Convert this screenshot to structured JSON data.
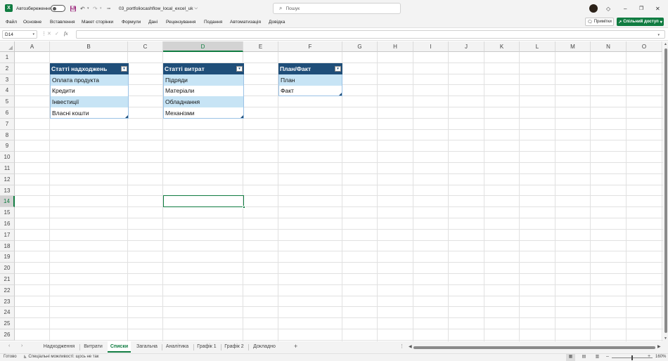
{
  "titlebar": {
    "app_icon": "X",
    "autosave_label": "Автозбереження",
    "autosave_state": "off",
    "filename": "03_portfoliocashflow_local_excel_uk",
    "filename_chevron": "⌵",
    "search_placeholder": "Пошук",
    "icons": [
      "excel-logo-icon",
      "save-icon",
      "undo-icon",
      "redo-icon",
      "search-icon",
      "diamond-icon",
      "minimize-icon",
      "maximize-icon",
      "close-icon"
    ]
  },
  "ribbon": {
    "tabs": [
      "Файл",
      "Основне",
      "Вставлення",
      "Макет сторінки",
      "Формули",
      "Дані",
      "Рецензування",
      "Подання",
      "Автоматизація",
      "Довідка"
    ],
    "notes_label": "Примітки",
    "share_label": "Спільний доступ"
  },
  "formula_bar": {
    "name_box": "D14",
    "fx_label": "fx",
    "formula": ""
  },
  "grid": {
    "columns": [
      "A",
      "B",
      "C",
      "D",
      "E",
      "F",
      "G",
      "H",
      "I",
      "J",
      "K",
      "L",
      "M",
      "N",
      "O"
    ],
    "rows": [
      "1",
      "2",
      "3",
      "4",
      "5",
      "6",
      "7",
      "8",
      "9",
      "10",
      "11",
      "12",
      "13",
      "14",
      "15",
      "16",
      "17",
      "18",
      "19",
      "20",
      "21",
      "22",
      "23",
      "24",
      "25",
      "26"
    ],
    "selected_column": "D",
    "selected_row": "14"
  },
  "tables": {
    "income": {
      "header": "Статті надходжень",
      "items": [
        "Оплата продукта",
        "Кредити",
        "Інвестиції",
        "Власні кошти"
      ]
    },
    "expenses": {
      "header": "Статті витрат",
      "items": [
        "Підряди",
        "Матеріали",
        "Обладнання",
        "Механізми"
      ]
    },
    "planfact": {
      "header": "План/Факт",
      "items": [
        "План",
        "Факт"
      ]
    },
    "header_color": "#1f4e79",
    "band_color": "#c7e4f5"
  },
  "sheets": {
    "tabs": [
      "Надходження",
      "Витрати",
      "Списки",
      "Загальна",
      "Аналітика",
      "Графік 1",
      "Графік 2",
      "Докладно"
    ],
    "active": "Списки"
  },
  "statusbar": {
    "ready": "Готово",
    "accessibility": "Спеціальні можливості: щось не так",
    "zoom": "160%"
  },
  "colors": {
    "accent": "#107c41"
  }
}
